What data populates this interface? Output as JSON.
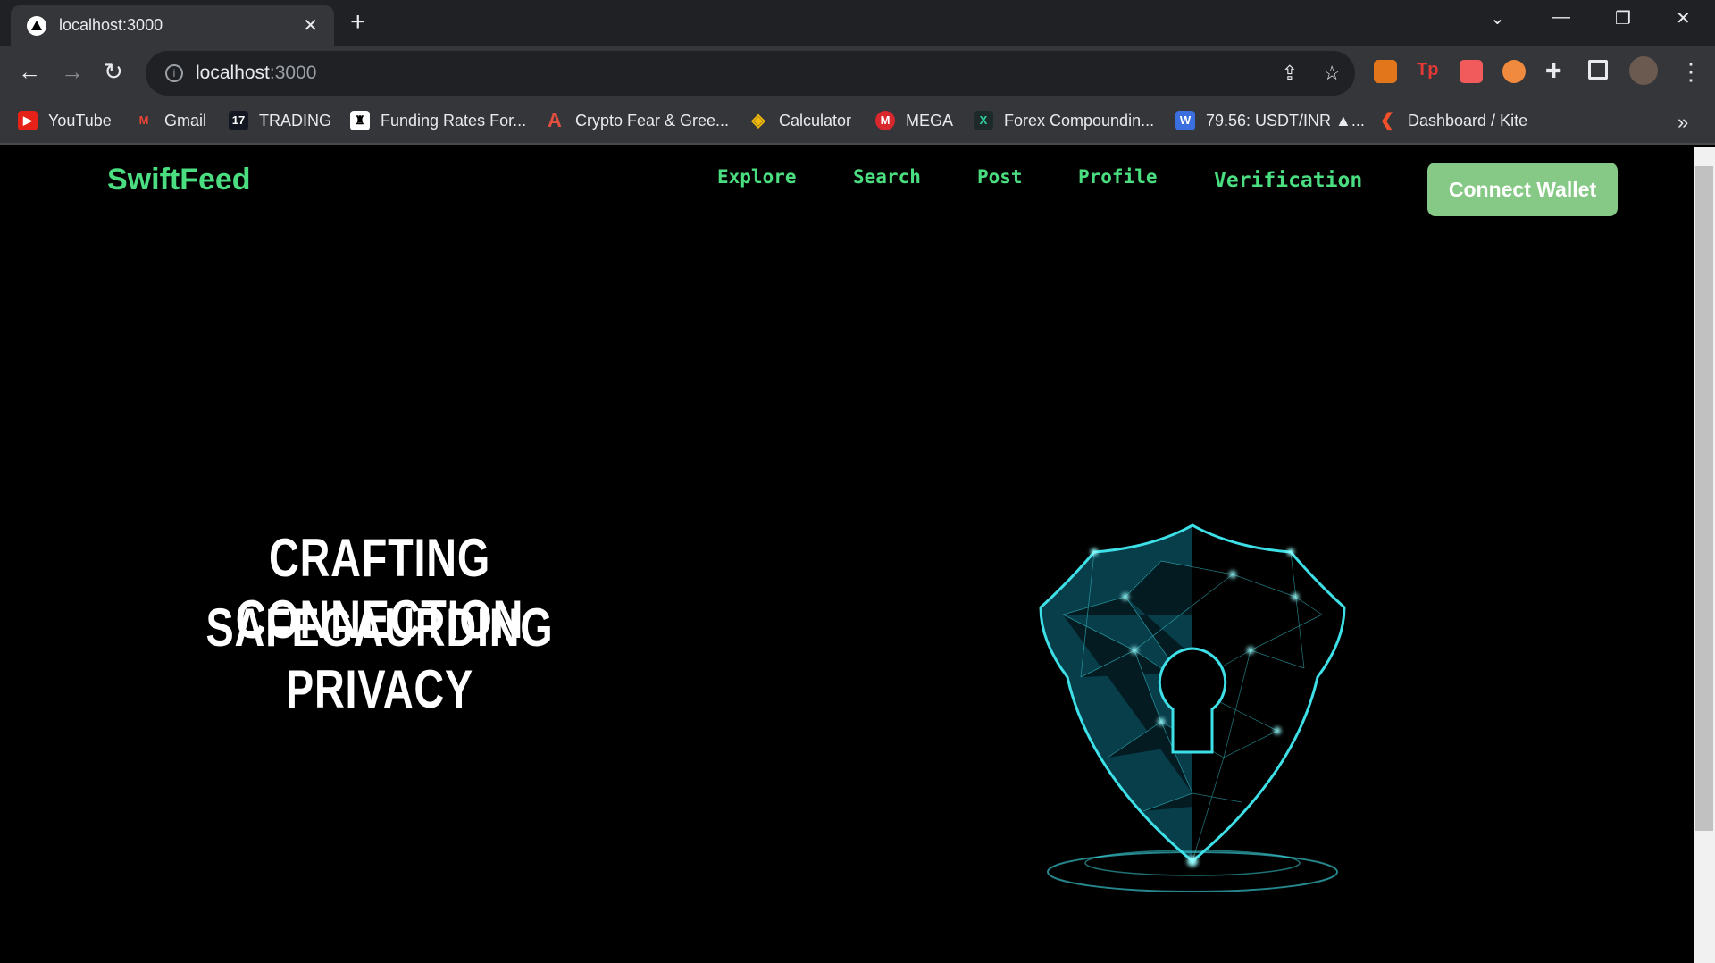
{
  "browser": {
    "tab_title": "localhost:3000",
    "url_host": "localhost",
    "url_port": ":3000",
    "bookmarks": [
      "YouTube",
      "Gmail",
      "TRADING",
      "Funding Rates For...",
      "Crypto Fear & Gree...",
      "Calculator",
      "MEGA",
      "Forex Compoundin...",
      "79.56: USDT/INR ▲...",
      "Dashboard / Kite"
    ],
    "overflow": "»"
  },
  "header": {
    "logo": "SwiftFeed",
    "nav": [
      "Explore",
      "Search",
      "Post",
      "Profile",
      "Verification"
    ],
    "connect_wallet": "Connect Wallet"
  },
  "hero": {
    "line1": "CRAFTING CONNECTION",
    "line2": "SAFEGAURDING PRIVACY"
  },
  "colors": {
    "accent": "#4ade80",
    "button": "#86c986",
    "shield": "#3ee0e8"
  }
}
